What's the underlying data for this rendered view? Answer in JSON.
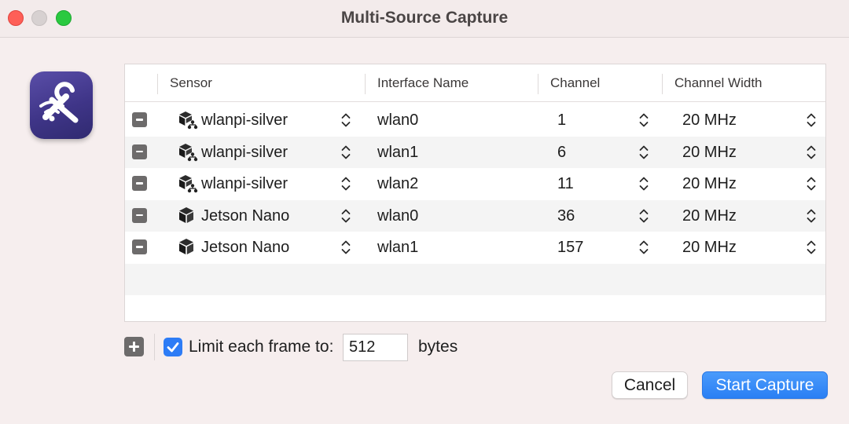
{
  "window": {
    "title": "Multi-Source Capture"
  },
  "table": {
    "columns": [
      "Sensor",
      "Interface Name",
      "Channel",
      "Channel Width"
    ],
    "rows": [
      {
        "sensor": "wlanpi-silver",
        "sensor_icon": "network-cube-icon",
        "interface": "wlan0",
        "channel": "1",
        "width": "20 MHz"
      },
      {
        "sensor": "wlanpi-silver",
        "sensor_icon": "network-cube-icon",
        "interface": "wlan1",
        "channel": "6",
        "width": "20 MHz"
      },
      {
        "sensor": "wlanpi-silver",
        "sensor_icon": "network-cube-icon",
        "interface": "wlan2",
        "channel": "11",
        "width": "20 MHz"
      },
      {
        "sensor": "Jetson Nano",
        "sensor_icon": "cube-icon",
        "interface": "wlan0",
        "channel": "36",
        "width": "20 MHz"
      },
      {
        "sensor": "Jetson Nano",
        "sensor_icon": "cube-icon",
        "interface": "wlan1",
        "channel": "157",
        "width": "20 MHz"
      }
    ]
  },
  "options": {
    "limit_checked": true,
    "limit_label": "Limit each frame to:",
    "limit_value": "512",
    "limit_unit": "bytes"
  },
  "buttons": {
    "cancel": "Cancel",
    "start": "Start Capture"
  },
  "colors": {
    "accent": "#2d7cf6",
    "icon_bg": "#3f3588"
  }
}
